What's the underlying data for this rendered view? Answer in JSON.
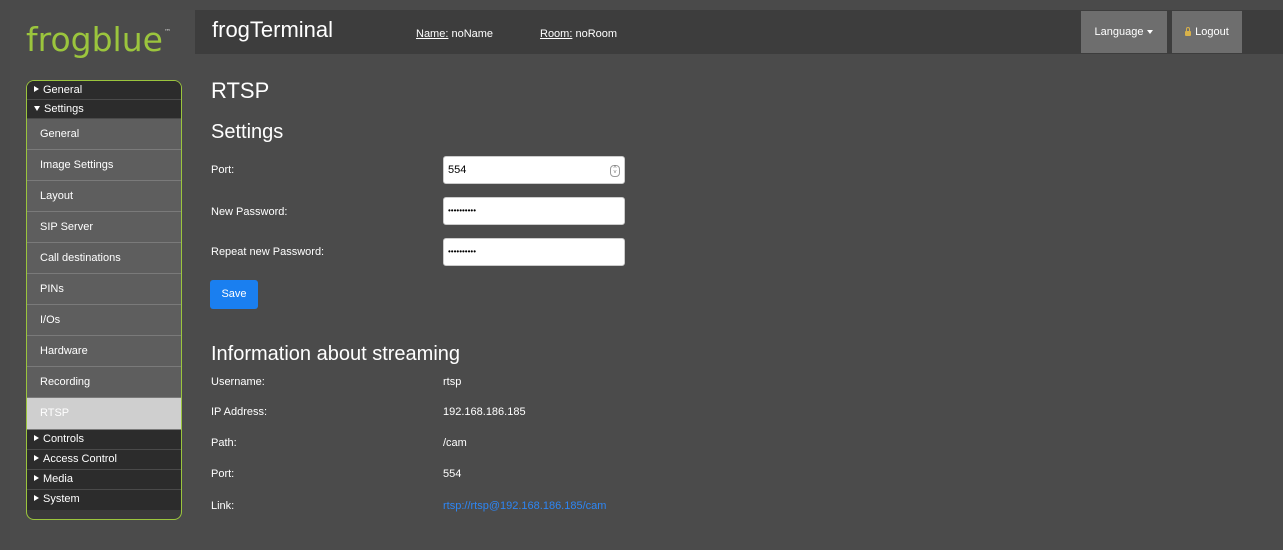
{
  "logo": {
    "text": "frogblue",
    "tm": "™"
  },
  "header": {
    "app_title": "frogTerminal",
    "name_label": "Name:",
    "name_value": "noName",
    "room_label": "Room:",
    "room_value": "noRoom",
    "language_label": "Language",
    "logout_label": "Logout"
  },
  "sidebar": {
    "groups": {
      "general": "General",
      "settings": "Settings",
      "controls": "Controls",
      "access_control": "Access Control",
      "media": "Media",
      "system": "System"
    },
    "items": [
      {
        "label": "General"
      },
      {
        "label": "Image Settings"
      },
      {
        "label": "Layout"
      },
      {
        "label": "SIP Server"
      },
      {
        "label": "Call destinations"
      },
      {
        "label": "PINs"
      },
      {
        "label": "I/Os"
      },
      {
        "label": "Hardware"
      },
      {
        "label": "Recording"
      },
      {
        "label": "RTSP"
      }
    ],
    "active": "RTSP"
  },
  "main": {
    "title": "RTSP",
    "settings_heading": "Settings",
    "port_label": "Port:",
    "port_value": "554",
    "new_password_label": "New Password:",
    "new_password_value": "••••••••••",
    "repeat_password_label": "Repeat new Password:",
    "repeat_password_value": "••••••••••",
    "save_label": "Save",
    "info_heading": "Information about streaming",
    "info": {
      "username_label": "Username:",
      "username_value": "rtsp",
      "ip_label": "IP Address:",
      "ip_value": "192.168.186.185",
      "path_label": "Path:",
      "path_value": "/cam",
      "port_label": "Port:",
      "port_value": "554",
      "link_label": "Link:",
      "link_value": "rtsp://rtsp@192.168.186.185/cam"
    }
  },
  "colors": {
    "background": "#4b4b4b",
    "brand_green": "#9bc53d",
    "accent_blue": "#1a7ff0",
    "link_blue": "#2d86f5"
  }
}
